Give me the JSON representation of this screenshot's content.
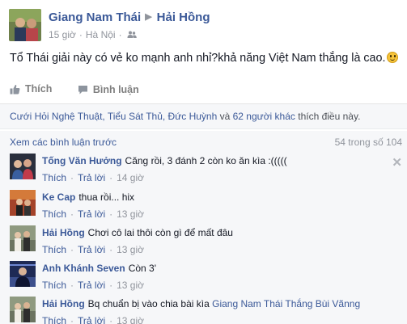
{
  "post": {
    "author": "Giang Nam Thái",
    "target": "Hải Hồng",
    "time": "15 giờ",
    "location": "Hà Nội",
    "text": "Tổ Thái giải này có vẻ ko mạnh anh nhỉ?khả năng Việt Nam thắng là cao."
  },
  "actions": {
    "like": "Thích",
    "comment": "Bình luận"
  },
  "likes": {
    "names": "Cưới Hỏi Nghệ Thuật, Tiểu Sát Thủ, Đức Huỳnh",
    "and": " và ",
    "others": "62 người khác",
    "suffix": " thích điều này."
  },
  "comments_header": {
    "more": "Xem các bình luận trước",
    "count": "54 trong số 104"
  },
  "comments": [
    {
      "name": "Tống Văn Hưởng",
      "text": "Căng rồi, 3 đánh 2 còn ko ăn kìa :(((((",
      "like": "Thích",
      "reply": "Trả lời",
      "time": "14 giờ"
    },
    {
      "name": "Ke Cap",
      "text": "thua rồi... hix",
      "like": "Thích",
      "reply": "Trả lời",
      "time": "13 giờ"
    },
    {
      "name": "Hải Hồng",
      "text": "Chơi cô lai thôi còn gì để mất đâu",
      "like": "Thích",
      "reply": "Trả lời",
      "time": "13 giờ"
    },
    {
      "name": "Anh Khánh Seven",
      "text": "Còn 3'",
      "like": "Thích",
      "reply": "Trả lời",
      "time": "13 giờ"
    },
    {
      "name": "Hải Hồng",
      "text": "Bq chuẩn bị vào chia bài kìa ",
      "tag1": "Giang Nam Thái",
      "tag2": "Thắng Bùi Vãnng",
      "like": "Thích",
      "reply": "Trả lời",
      "time": "13 giờ"
    }
  ]
}
